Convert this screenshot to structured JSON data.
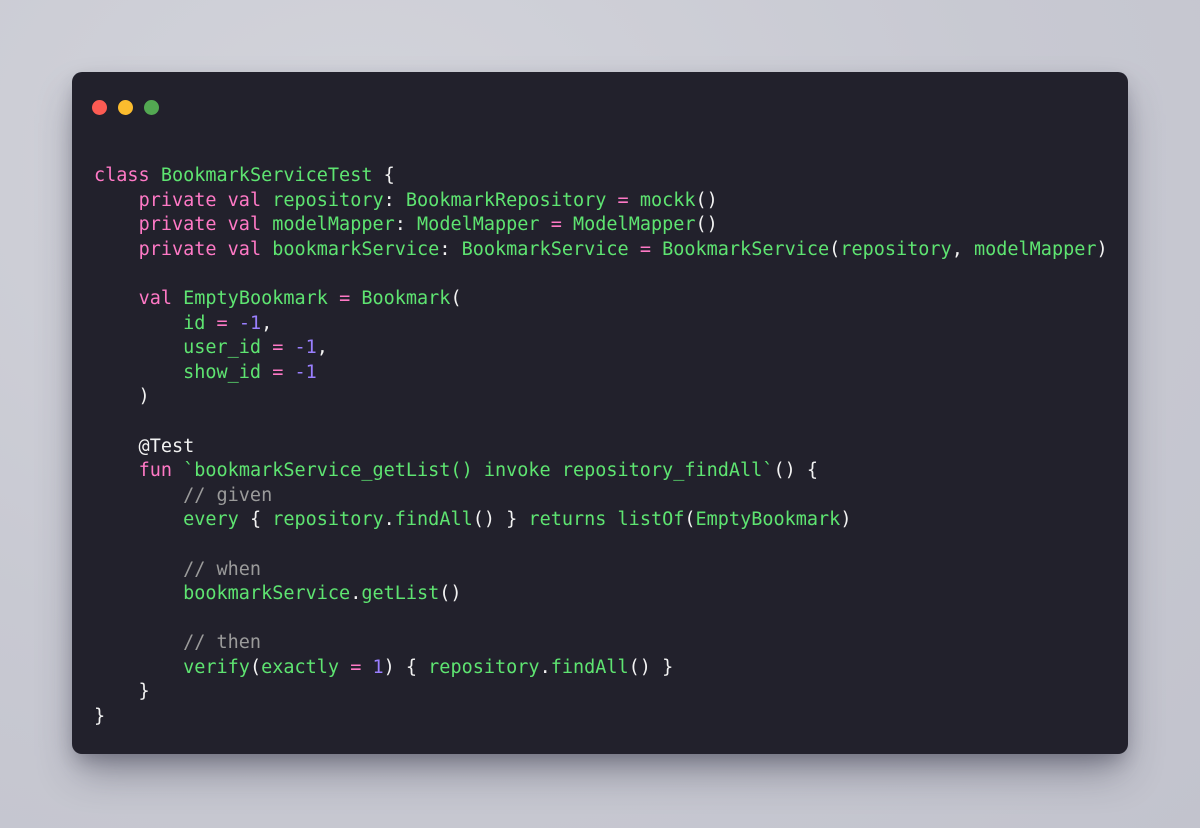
{
  "window": {
    "name": "code-snippet-card",
    "dots": [
      {
        "name": "close",
        "label": "Close",
        "color": "#fc5b53"
      },
      {
        "name": "minimize",
        "label": "Minimize",
        "color": "#fbbc2e"
      },
      {
        "name": "zoom",
        "label": "Zoom",
        "color": "#53a852"
      }
    ]
  },
  "theme": {
    "page_background": "#cdced6",
    "card_background": "#22212c",
    "keyword": "#ff79c6",
    "identifier": "#5ee471",
    "number": "#9a7fff",
    "comment": "#9b9b9b",
    "plain": "#f2f2f2"
  },
  "code": {
    "language": "kotlin",
    "plain_text": "class BookmarkServiceTest {\n    private val repository: BookmarkRepository = mockk()\n    private val modelMapper: ModelMapper = ModelMapper()\n    private val bookmarkService: BookmarkService = BookmarkService(repository, modelMapper)\n\n    val EmptyBookmark = Bookmark(\n        id = -1,\n        user_id = -1,\n        show_id = -1\n    )\n\n    @Test\n    fun `bookmarkService_getList() invoke repository_findAll`() {\n        // given\n        every { repository.findAll() } returns listOf(EmptyBookmark)\n\n        // when\n        bookmarkService.getList()\n\n        // then\n        verify(exactly = 1) { repository.findAll() }\n    }\n}",
    "lines": [
      {
        "n": 1,
        "tokens": [
          {
            "t": "kw",
            "v": "class"
          },
          {
            "t": "pl",
            "v": " "
          },
          {
            "t": "id",
            "v": "BookmarkServiceTest"
          },
          {
            "t": "pl",
            "v": " {"
          }
        ]
      },
      {
        "n": 2,
        "tokens": [
          {
            "t": "pl",
            "v": "    "
          },
          {
            "t": "kw",
            "v": "private val"
          },
          {
            "t": "pl",
            "v": " "
          },
          {
            "t": "id",
            "v": "repository"
          },
          {
            "t": "pl",
            "v": ": "
          },
          {
            "t": "id",
            "v": "BookmarkRepository"
          },
          {
            "t": "pl",
            "v": " "
          },
          {
            "t": "op",
            "v": "="
          },
          {
            "t": "pl",
            "v": " "
          },
          {
            "t": "id",
            "v": "mockk"
          },
          {
            "t": "pl",
            "v": "()"
          }
        ]
      },
      {
        "n": 3,
        "tokens": [
          {
            "t": "pl",
            "v": "    "
          },
          {
            "t": "kw",
            "v": "private val"
          },
          {
            "t": "pl",
            "v": " "
          },
          {
            "t": "id",
            "v": "modelMapper"
          },
          {
            "t": "pl",
            "v": ": "
          },
          {
            "t": "id",
            "v": "ModelMapper"
          },
          {
            "t": "pl",
            "v": " "
          },
          {
            "t": "op",
            "v": "="
          },
          {
            "t": "pl",
            "v": " "
          },
          {
            "t": "id",
            "v": "ModelMapper"
          },
          {
            "t": "pl",
            "v": "()"
          }
        ]
      },
      {
        "n": 4,
        "tokens": [
          {
            "t": "pl",
            "v": "    "
          },
          {
            "t": "kw",
            "v": "private val"
          },
          {
            "t": "pl",
            "v": " "
          },
          {
            "t": "id",
            "v": "bookmarkService"
          },
          {
            "t": "pl",
            "v": ": "
          },
          {
            "t": "id",
            "v": "BookmarkService"
          },
          {
            "t": "pl",
            "v": " "
          },
          {
            "t": "op",
            "v": "="
          },
          {
            "t": "pl",
            "v": " "
          },
          {
            "t": "id",
            "v": "BookmarkService"
          },
          {
            "t": "pl",
            "v": "("
          },
          {
            "t": "id",
            "v": "repository"
          },
          {
            "t": "pl",
            "v": ", "
          },
          {
            "t": "id",
            "v": "modelMapper"
          },
          {
            "t": "pl",
            "v": ")"
          }
        ]
      },
      {
        "n": 5,
        "tokens": []
      },
      {
        "n": 6,
        "tokens": [
          {
            "t": "pl",
            "v": "    "
          },
          {
            "t": "kw",
            "v": "val"
          },
          {
            "t": "pl",
            "v": " "
          },
          {
            "t": "id",
            "v": "EmptyBookmark"
          },
          {
            "t": "pl",
            "v": " "
          },
          {
            "t": "op",
            "v": "="
          },
          {
            "t": "pl",
            "v": " "
          },
          {
            "t": "id",
            "v": "Bookmark"
          },
          {
            "t": "pl",
            "v": "("
          }
        ]
      },
      {
        "n": 7,
        "tokens": [
          {
            "t": "pl",
            "v": "        "
          },
          {
            "t": "id",
            "v": "id"
          },
          {
            "t": "pl",
            "v": " "
          },
          {
            "t": "op",
            "v": "="
          },
          {
            "t": "pl",
            "v": " "
          },
          {
            "t": "num",
            "v": "-1"
          },
          {
            "t": "pl",
            "v": ","
          }
        ]
      },
      {
        "n": 8,
        "tokens": [
          {
            "t": "pl",
            "v": "        "
          },
          {
            "t": "id",
            "v": "user_id"
          },
          {
            "t": "pl",
            "v": " "
          },
          {
            "t": "op",
            "v": "="
          },
          {
            "t": "pl",
            "v": " "
          },
          {
            "t": "num",
            "v": "-1"
          },
          {
            "t": "pl",
            "v": ","
          }
        ]
      },
      {
        "n": 9,
        "tokens": [
          {
            "t": "pl",
            "v": "        "
          },
          {
            "t": "id",
            "v": "show_id"
          },
          {
            "t": "pl",
            "v": " "
          },
          {
            "t": "op",
            "v": "="
          },
          {
            "t": "pl",
            "v": " "
          },
          {
            "t": "num",
            "v": "-1"
          }
        ]
      },
      {
        "n": 10,
        "tokens": [
          {
            "t": "pl",
            "v": "    )"
          }
        ]
      },
      {
        "n": 11,
        "tokens": []
      },
      {
        "n": 12,
        "tokens": [
          {
            "t": "pl",
            "v": "    @Test"
          }
        ]
      },
      {
        "n": 13,
        "tokens": [
          {
            "t": "pl",
            "v": "    "
          },
          {
            "t": "kw",
            "v": "fun"
          },
          {
            "t": "pl",
            "v": " "
          },
          {
            "t": "id",
            "v": "`bookmarkService_getList() invoke repository_findAll`"
          },
          {
            "t": "pl",
            "v": "() {"
          }
        ]
      },
      {
        "n": 14,
        "tokens": [
          {
            "t": "pl",
            "v": "        "
          },
          {
            "t": "cm",
            "v": "// given"
          }
        ]
      },
      {
        "n": 15,
        "tokens": [
          {
            "t": "pl",
            "v": "        "
          },
          {
            "t": "id",
            "v": "every"
          },
          {
            "t": "pl",
            "v": " { "
          },
          {
            "t": "id",
            "v": "repository"
          },
          {
            "t": "pl",
            "v": "."
          },
          {
            "t": "id",
            "v": "findAll"
          },
          {
            "t": "pl",
            "v": "() } "
          },
          {
            "t": "id",
            "v": "returns"
          },
          {
            "t": "pl",
            "v": " "
          },
          {
            "t": "id",
            "v": "listOf"
          },
          {
            "t": "pl",
            "v": "("
          },
          {
            "t": "id",
            "v": "EmptyBookmark"
          },
          {
            "t": "pl",
            "v": ")"
          }
        ]
      },
      {
        "n": 16,
        "tokens": []
      },
      {
        "n": 17,
        "tokens": [
          {
            "t": "pl",
            "v": "        "
          },
          {
            "t": "cm",
            "v": "// when"
          }
        ]
      },
      {
        "n": 18,
        "tokens": [
          {
            "t": "pl",
            "v": "        "
          },
          {
            "t": "id",
            "v": "bookmarkService"
          },
          {
            "t": "pl",
            "v": "."
          },
          {
            "t": "id",
            "v": "getList"
          },
          {
            "t": "pl",
            "v": "()"
          }
        ]
      },
      {
        "n": 19,
        "tokens": []
      },
      {
        "n": 20,
        "tokens": [
          {
            "t": "pl",
            "v": "        "
          },
          {
            "t": "cm",
            "v": "// then"
          }
        ]
      },
      {
        "n": 21,
        "tokens": [
          {
            "t": "pl",
            "v": "        "
          },
          {
            "t": "id",
            "v": "verify"
          },
          {
            "t": "pl",
            "v": "("
          },
          {
            "t": "id",
            "v": "exactly"
          },
          {
            "t": "pl",
            "v": " "
          },
          {
            "t": "op",
            "v": "="
          },
          {
            "t": "pl",
            "v": " "
          },
          {
            "t": "num",
            "v": "1"
          },
          {
            "t": "pl",
            "v": ") { "
          },
          {
            "t": "id",
            "v": "repository"
          },
          {
            "t": "pl",
            "v": "."
          },
          {
            "t": "id",
            "v": "findAll"
          },
          {
            "t": "pl",
            "v": "() }"
          }
        ]
      },
      {
        "n": 22,
        "tokens": [
          {
            "t": "pl",
            "v": "    }"
          }
        ]
      },
      {
        "n": 23,
        "tokens": [
          {
            "t": "pl",
            "v": "}"
          }
        ]
      }
    ]
  }
}
